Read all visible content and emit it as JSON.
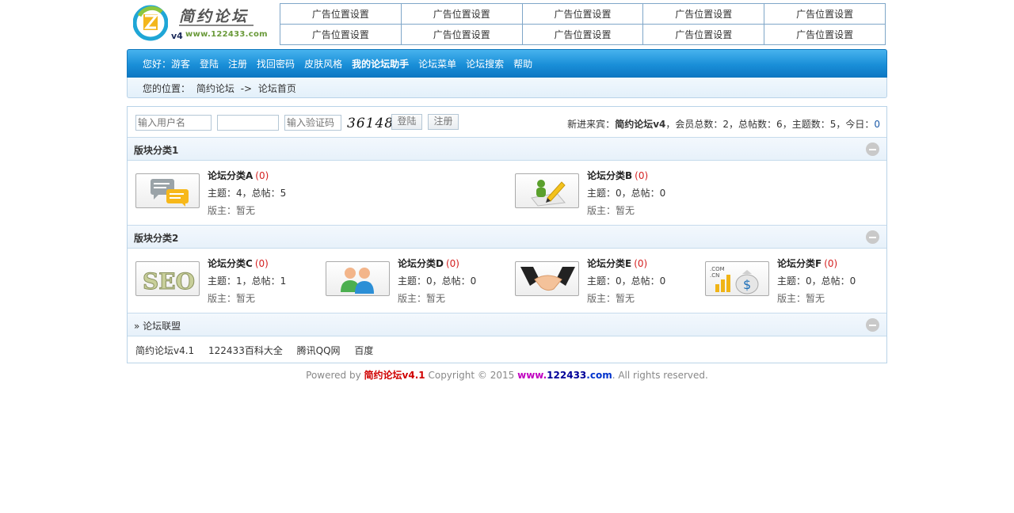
{
  "logo": {
    "title": "简约论坛",
    "version": "v4",
    "url": "www.122433.com"
  },
  "ads": [
    [
      "广告位置设置",
      "广告位置设置",
      "广告位置设置",
      "广告位置设置",
      "广告位置设置"
    ],
    [
      "广告位置设置",
      "广告位置设置",
      "广告位置设置",
      "广告位置设置",
      "广告位置设置"
    ]
  ],
  "nav": {
    "greeting": "您好：游客",
    "items": [
      "登陆",
      "注册",
      "找回密码",
      "皮肤风格",
      "我的论坛助手",
      "论坛菜单",
      "论坛搜索",
      "帮助"
    ]
  },
  "breadcrumb": {
    "label": "您的位置：",
    "site": "简约论坛",
    "sep": "->",
    "current": "论坛首页"
  },
  "login": {
    "username_placeholder": "输入用户名",
    "password_placeholder": "",
    "captcha_placeholder": "输入验证码",
    "captcha": "36148",
    "login_btn": "登陆",
    "register_btn": "注册"
  },
  "stats": {
    "prefix": "新进来宾：",
    "newest": "简约论坛v4",
    "members_label": "，会员总数：",
    "members": "2",
    "posts_label": "，总帖数：",
    "posts": "6",
    "topics_label": "，主题数：",
    "topics": "5",
    "today_label": "，今日：",
    "today": "0"
  },
  "sections": [
    {
      "title": "版块分类1",
      "forums": [
        {
          "name": "论坛分类A",
          "count": "(0)",
          "stats": "主题：4，总帖：5",
          "mod": "版主：暂无",
          "icon": "chat-bubbles-icon"
        },
        {
          "name": "论坛分类B",
          "count": "(0)",
          "stats": "主题：0，总帖：0",
          "mod": "版主：暂无",
          "icon": "pencil-writing-icon"
        }
      ]
    },
    {
      "title": "版块分类2",
      "forums": [
        {
          "name": "论坛分类C",
          "count": "(0)",
          "stats": "主题：1，总帖：1",
          "mod": "版主：暂无",
          "icon": "seo-icon"
        },
        {
          "name": "论坛分类D",
          "count": "(0)",
          "stats": "主题：0，总帖：0",
          "mod": "版主：暂无",
          "icon": "users-icon"
        },
        {
          "name": "论坛分类E",
          "count": "(0)",
          "stats": "主题：0，总帖：0",
          "mod": "版主：暂无",
          "icon": "handshake-icon"
        },
        {
          "name": "论坛分类F",
          "count": "(0)",
          "stats": "主题：0，总帖：0",
          "mod": "版主：暂无",
          "icon": "money-bag-icon"
        }
      ]
    }
  ],
  "alliance": {
    "title": "» 论坛联盟",
    "links": [
      "简约论坛v4.1",
      "122433百科大全",
      "腾讯QQ网",
      "百度"
    ]
  },
  "footer": {
    "powered": "Powered by",
    "brand": "简约论坛v4.1",
    "copyright": "Copyright © 2015",
    "www": "www.",
    "domain": "122433",
    "tld": ".com",
    "rights": ". All rights reserved."
  },
  "colors": {
    "nav_blue": "#1a8fd8",
    "count_red": "#d42020",
    "accent_link": "#1a5aa8"
  }
}
